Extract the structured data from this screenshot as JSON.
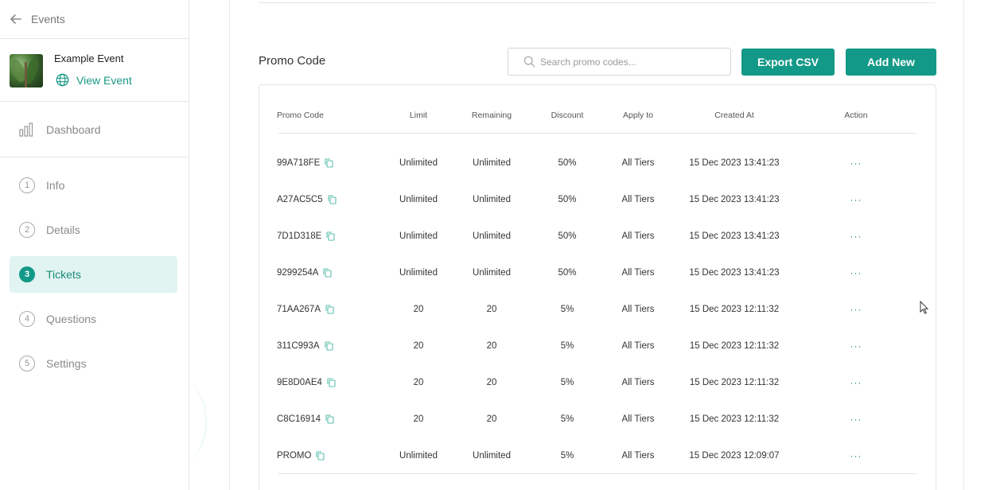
{
  "sidebar": {
    "back_label": "Events",
    "event_name": "Example Event",
    "view_event_label": "View Event",
    "dashboard_label": "Dashboard",
    "steps": [
      {
        "num": "1",
        "label": "Info"
      },
      {
        "num": "2",
        "label": "Details"
      },
      {
        "num": "3",
        "label": "Tickets"
      },
      {
        "num": "4",
        "label": "Questions"
      },
      {
        "num": "5",
        "label": "Settings"
      }
    ],
    "active_step": "Tickets"
  },
  "promo": {
    "title": "Promo Code",
    "search_placeholder": "Search promo codes...",
    "export_label": "Export CSV",
    "add_label": "Add New",
    "columns": [
      "Promo Code",
      "Limit",
      "Remaining",
      "Discount",
      "Apply to",
      "Created At",
      "Action"
    ],
    "rows": [
      {
        "code": "99A718FE",
        "limit": "Unlimited",
        "remaining": "Unlimited",
        "discount": "50%",
        "apply_to": "All Tiers",
        "created_at": "15 Dec 2023 13:41:23",
        "action": "···"
      },
      {
        "code": "A27AC5C5",
        "limit": "Unlimited",
        "remaining": "Unlimited",
        "discount": "50%",
        "apply_to": "All Tiers",
        "created_at": "15 Dec 2023 13:41:23",
        "action": "···"
      },
      {
        "code": "7D1D318E",
        "limit": "Unlimited",
        "remaining": "Unlimited",
        "discount": "50%",
        "apply_to": "All Tiers",
        "created_at": "15 Dec 2023 13:41:23",
        "action": "···"
      },
      {
        "code": "9299254A",
        "limit": "Unlimited",
        "remaining": "Unlimited",
        "discount": "50%",
        "apply_to": "All Tiers",
        "created_at": "15 Dec 2023 13:41:23",
        "action": "···"
      },
      {
        "code": "71AA267A",
        "limit": "20",
        "remaining": "20",
        "discount": "5%",
        "apply_to": "All Tiers",
        "created_at": "15 Dec 2023 12:11:32",
        "action": "···"
      },
      {
        "code": "311C993A",
        "limit": "20",
        "remaining": "20",
        "discount": "5%",
        "apply_to": "All Tiers",
        "created_at": "15 Dec 2023 12:11:32",
        "action": "···"
      },
      {
        "code": "9E8D0AE4",
        "limit": "20",
        "remaining": "20",
        "discount": "5%",
        "apply_to": "All Tiers",
        "created_at": "15 Dec 2023 12:11:32",
        "action": "···"
      },
      {
        "code": "C8C16914",
        "limit": "20",
        "remaining": "20",
        "discount": "5%",
        "apply_to": "All Tiers",
        "created_at": "15 Dec 2023 12:11:32",
        "action": "···"
      },
      {
        "code": "PROMO",
        "limit": "Unlimited",
        "remaining": "Unlimited",
        "discount": "5%",
        "apply_to": "All Tiers",
        "created_at": "15 Dec 2023 12:09:07",
        "action": "···"
      }
    ]
  },
  "colors": {
    "accent": "#139987",
    "accent_light": "#e1f4f1",
    "link": "#1a9a86"
  }
}
